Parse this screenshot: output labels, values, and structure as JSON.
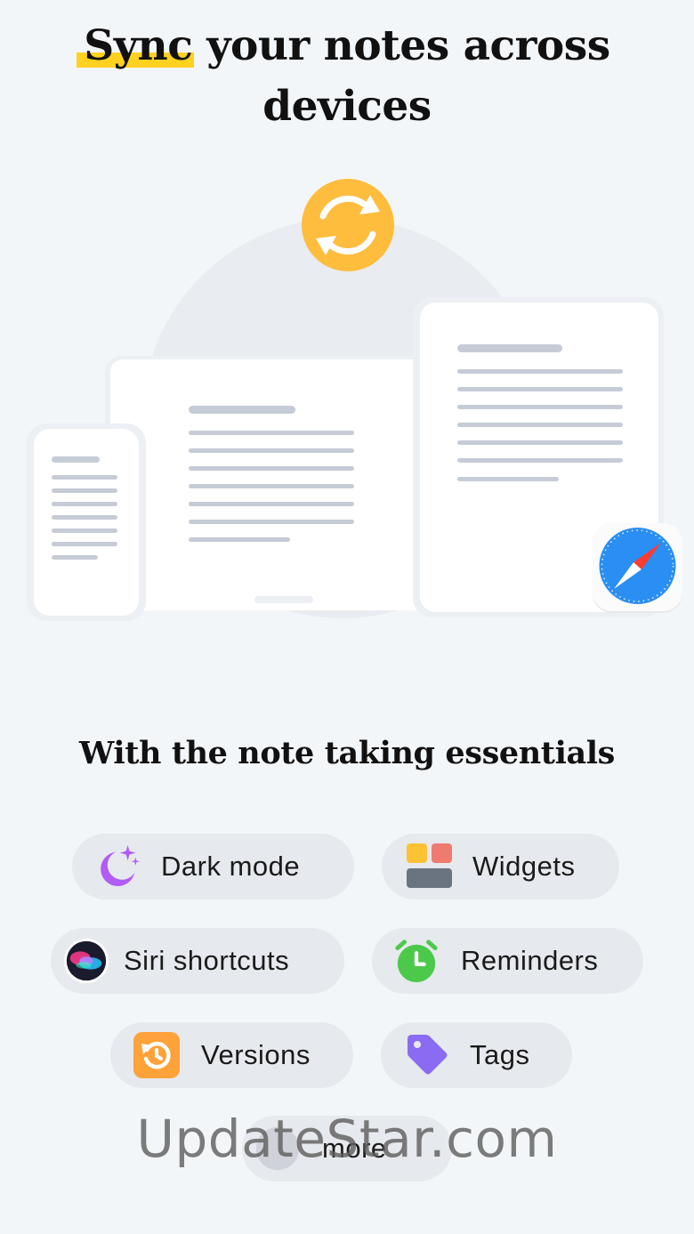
{
  "header": {
    "title_highlight": "Sync",
    "title_rest_line1": " your notes across",
    "title_line2": "devices"
  },
  "illustration": {
    "sync_icon": "sync-arrows-icon",
    "browser_icon": "safari-compass-icon",
    "colors": {
      "sync_badge": "#ffbd3d",
      "card": "#ffffff",
      "text_line": "#c6ccd5"
    }
  },
  "features": {
    "subtitle": "With the note taking essentials",
    "chips": [
      {
        "label": "Dark mode",
        "icon": "moon-stars-icon"
      },
      {
        "label": "Widgets",
        "icon": "widgets-grid-icon"
      },
      {
        "label": "Siri shortcuts",
        "icon": "siri-orb-icon"
      },
      {
        "label": "Reminders",
        "icon": "alarm-clock-icon"
      },
      {
        "label": "Versions",
        "icon": "history-arrow-icon"
      },
      {
        "label": "Tags",
        "icon": "tag-icon"
      },
      {
        "label": "more",
        "icon": "more-icon"
      }
    ]
  },
  "watermark": "UpdateStar.com"
}
